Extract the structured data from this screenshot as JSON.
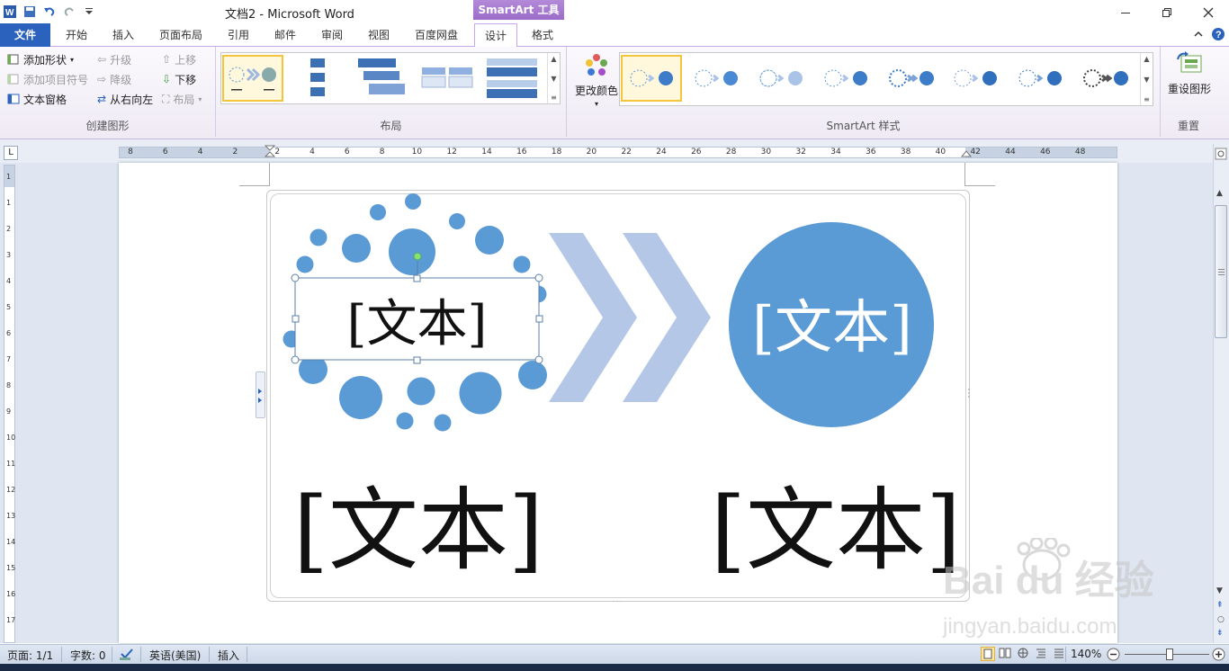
{
  "app": {
    "title": "文档2 - Microsoft Word",
    "context_tab_header": "SmartArt 工具"
  },
  "tabs": [
    "文件",
    "开始",
    "插入",
    "页面布局",
    "引用",
    "邮件",
    "审阅",
    "视图",
    "百度网盘",
    "设计",
    "格式"
  ],
  "ribbon": {
    "create_graphic": {
      "label": "创建图形",
      "add_shape": "添加形状",
      "add_bullet": "添加项目符号",
      "text_pane": "文本窗格",
      "promote": "升级",
      "demote": "降级",
      "right_to_left": "从右向左",
      "move_up": "上移",
      "move_down": "下移",
      "layout": "布局"
    },
    "layouts": {
      "label": "布局"
    },
    "styles": {
      "label": "SmartArt 样式",
      "change_colors": "更改颜色"
    },
    "reset": {
      "label": "重置",
      "reset_graphic": "重设图形"
    }
  },
  "ruler_ticks": [
    "8",
    "6",
    "4",
    "2",
    "2",
    "4",
    "6",
    "8",
    "10",
    "12",
    "14",
    "16",
    "18",
    "20",
    "22",
    "24",
    "26",
    "28",
    "30",
    "32",
    "34",
    "36",
    "38",
    "40",
    "42",
    "44",
    "46",
    "48"
  ],
  "vruler_ticks": [
    "1",
    "1",
    "2",
    "3",
    "4",
    "5",
    "6",
    "7",
    "8",
    "9",
    "10",
    "11",
    "12",
    "13",
    "14",
    "15",
    "16",
    "17"
  ],
  "smartart": {
    "small_box_text": "[文本]",
    "circle_text": "[文本]",
    "bottom_left_text": "[文本]",
    "bottom_right_text": "[文本]"
  },
  "status": {
    "page": "页面: 1/1",
    "words": "字数: 0",
    "language": "英语(美国)",
    "mode": "插入",
    "zoom": "140%"
  },
  "watermark": {
    "brand": "Bai du 经验",
    "url": "jingyan.baidu.com"
  },
  "colors": {
    "accent_blue": "#5b9bd5",
    "chevron": "#b4c7e7",
    "file_tab": "#2a62bd",
    "context_purple": "#9b6cc9"
  }
}
